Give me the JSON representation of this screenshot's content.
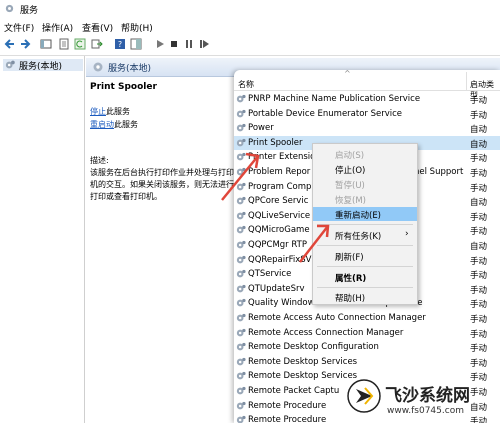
{
  "window": {
    "title": "服务"
  },
  "menubar": {
    "file": "文件(F)",
    "action": "操作(A)",
    "view": "查看(V)",
    "help": "帮助(H)"
  },
  "tree": {
    "node": "服务(本地)"
  },
  "pane": {
    "header": "服务(本地)"
  },
  "details": {
    "service_name": "Print Spooler",
    "stop_link": "停止",
    "stop_suffix": "此服务",
    "restart_link": "重启动",
    "restart_suffix": "此服务",
    "desc_label": "描述:",
    "description": "该服务在后台执行打印作业并处理与打印机的交互。如果关闭该服务，则无法进行打印或查看打印机。"
  },
  "list": {
    "col_name": "名称",
    "col_startup": "启动类型",
    "rows": [
      {
        "name": "PNRP Machine Name Publication Service",
        "startup": "手动"
      },
      {
        "name": "Portable Device Enumerator Service",
        "startup": "手动"
      },
      {
        "name": "Power",
        "startup": "自动"
      },
      {
        "name": "Print Spooler",
        "startup": "自动"
      },
      {
        "name": "Printer Extensio",
        "startup": "手动"
      },
      {
        "name": "Problem Repor",
        "startup": "手动"
      },
      {
        "name": "Program Comp",
        "startup": "手动"
      },
      {
        "name": "QPCore Servic",
        "startup": "自动"
      },
      {
        "name": "QQLiveService",
        "startup": "手动"
      },
      {
        "name": "QQMicroGame",
        "startup": "手动"
      },
      {
        "name": "QQPCMgr RTP",
        "startup": "自动"
      },
      {
        "name": "QQRepairFixSV",
        "startup": "手动"
      },
      {
        "name": "QTService",
        "startup": "手动"
      },
      {
        "name": "QTUpdateSrv",
        "startup": "手动"
      },
      {
        "name": "Quality Windows Audio Video Experience",
        "startup": "手动"
      },
      {
        "name": "Remote Access Auto Connection Manager",
        "startup": "手动"
      },
      {
        "name": "Remote Access Connection Manager",
        "startup": "手动"
      },
      {
        "name": "Remote Desktop Configuration",
        "startup": "手动"
      },
      {
        "name": "Remote Desktop Services",
        "startup": "手动"
      },
      {
        "name": "Remote Desktop Services",
        "startup": "手动"
      },
      {
        "name": "Remote Packet Captu",
        "startup": "手动"
      },
      {
        "name": "Remote Procedure",
        "startup": "自动"
      },
      {
        "name": "Remote Procedure",
        "startup": "手动"
      }
    ],
    "row6_tail": "nel Support"
  },
  "context_menu": {
    "start": "启动(S)",
    "stop": "停止(O)",
    "pause": "暂停(U)",
    "resume": "恢复(M)",
    "restart": "重新启动(E)",
    "all_tasks": "所有任务(K)",
    "refresh": "刷新(F)",
    "properties": "属性(R)",
    "help": "帮助(H)"
  },
  "watermark": {
    "brand": "飞沙系统网",
    "url": "www.fs0745.com"
  },
  "colors": {
    "selection": "#cce4f7",
    "highlight": "#91c9f7",
    "arrow": "#e0463a",
    "link": "#1c5bbf"
  }
}
